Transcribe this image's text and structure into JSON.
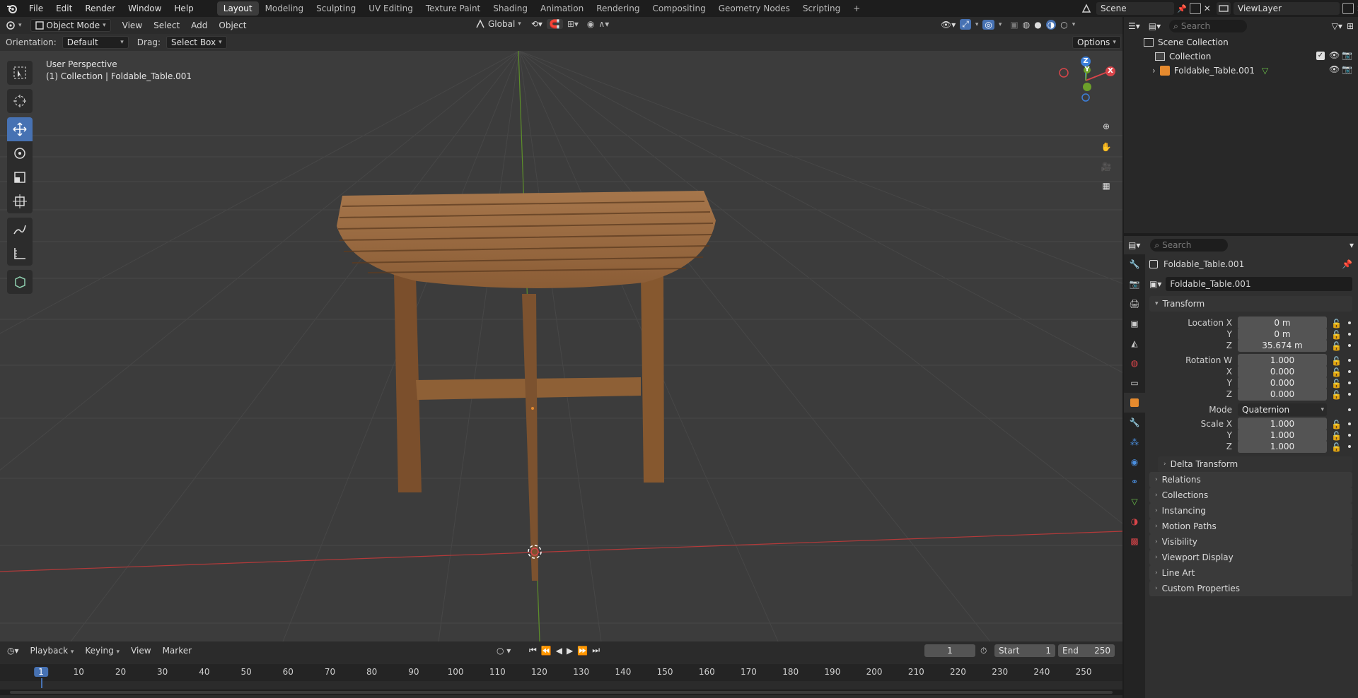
{
  "topbar": {
    "menus": [
      "File",
      "Edit",
      "Render",
      "Window",
      "Help"
    ],
    "workspaces": [
      "Layout",
      "Modeling",
      "Sculpting",
      "UV Editing",
      "Texture Paint",
      "Shading",
      "Animation",
      "Rendering",
      "Compositing",
      "Geometry Nodes",
      "Scripting"
    ],
    "active_workspace": "Layout",
    "add_tab": "+",
    "scene": "Scene",
    "view_layer": "ViewLayer"
  },
  "header": {
    "mode": "Object Mode",
    "menus": [
      "View",
      "Select",
      "Add",
      "Object"
    ],
    "transform_orientation": "Global"
  },
  "toolbar": {
    "orientation_label": "Orientation:",
    "orientation_value": "Default",
    "drag_label": "Drag:",
    "drag_value": "Select Box",
    "options": "Options"
  },
  "viewport": {
    "perspective": "User Perspective",
    "collection_info": "(1) Collection | Foldable_Table.001",
    "gizmo": {
      "z": "Z",
      "y": "Y",
      "x": "X"
    }
  },
  "timeline": {
    "menus": [
      "Playback",
      "Keying",
      "View",
      "Marker"
    ],
    "current_frame": "1",
    "start_label": "Start",
    "start": "1",
    "end_label": "End",
    "end": "250",
    "ruler": [
      "1",
      "10",
      "20",
      "30",
      "40",
      "50",
      "60",
      "70",
      "80",
      "90",
      "100",
      "110",
      "120",
      "130",
      "140",
      "150",
      "160",
      "170",
      "180",
      "190",
      "200",
      "210",
      "220",
      "230",
      "240",
      "250"
    ]
  },
  "outliner": {
    "search_placeholder": "Search",
    "items": [
      "Scene Collection",
      "Collection",
      "Foldable_Table.001"
    ]
  },
  "properties": {
    "search_placeholder": "Search",
    "object_name": "Foldable_Table.001",
    "object_field": "Foldable_Table.001",
    "transform_title": "Transform",
    "location": {
      "label": "Location X",
      "x": "0 m",
      "y": "0 m",
      "z": "35.674 m"
    },
    "rotation": {
      "label": "Rotation W",
      "w": "1.000",
      "x": "0.000",
      "y": "0.000",
      "z": "0.000"
    },
    "axis": {
      "x": "X",
      "y": "Y",
      "z": "Z"
    },
    "mode_label": "Mode",
    "mode_value": "Quaternion (WXYZ)",
    "scale": {
      "label": "Scale X",
      "x": "1.000",
      "y": "1.000",
      "z": "1.000"
    },
    "delta_transform": "Delta Transform",
    "panels": [
      "Relations",
      "Collections",
      "Instancing",
      "Motion Paths",
      "Visibility",
      "Viewport Display",
      "Line Art",
      "Custom Properties"
    ]
  },
  "colors": {
    "accent": "#4772b3",
    "x_axis": "#d9454a",
    "y_axis": "#6da02a",
    "z_axis": "#3d7fd9",
    "object": "#e58a2e"
  }
}
